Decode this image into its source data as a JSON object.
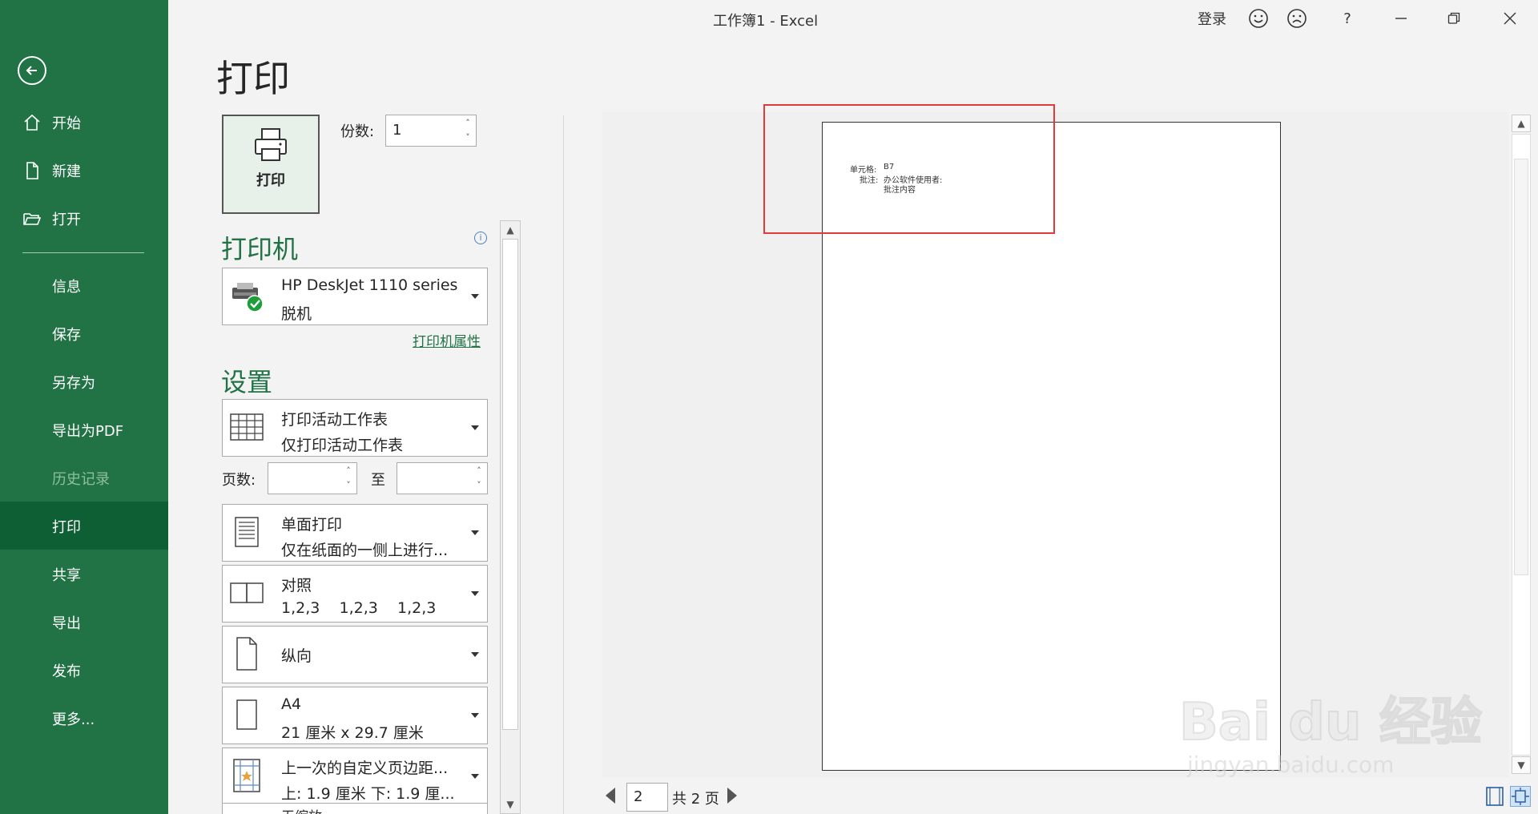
{
  "window": {
    "title": "工作簿1  -  Excel",
    "signin": "登录",
    "help": "?"
  },
  "sidebar": {
    "back_icon": "back-arrow-icon",
    "items": [
      {
        "label": "开始",
        "icon": "home-icon"
      },
      {
        "label": "新建",
        "icon": "new-document-icon"
      },
      {
        "label": "打开",
        "icon": "open-folder-icon"
      },
      {
        "label": "信息"
      },
      {
        "label": "保存"
      },
      {
        "label": "另存为"
      },
      {
        "label": "导出为PDF"
      },
      {
        "label": "历史记录",
        "disabled": true
      },
      {
        "label": "打印",
        "active": true
      },
      {
        "label": "共享"
      },
      {
        "label": "导出"
      },
      {
        "label": "发布"
      },
      {
        "label": "更多..."
      }
    ]
  },
  "print": {
    "heading": "打印",
    "button_label": "打印",
    "copies_label": "份数:",
    "copies_value": "1",
    "printer_section": "打印机",
    "printer_name": "HP DeskJet 1110 series",
    "printer_status": "脱机",
    "printer_properties": "打印机属性",
    "settings_section": "设置",
    "settings": {
      "scope_title": "打印活动工作表",
      "scope_sub": "仅打印活动工作表",
      "pages_label": "页数:",
      "pages_to": "至",
      "sides_title": "单面打印",
      "sides_sub": "仅在纸面的一侧上进行...",
      "collate_title": "对照",
      "collate_sub": "1,2,3    1,2,3    1,2,3",
      "orientation": "纵向",
      "paper_title": "A4",
      "paper_sub": "21 厘米 x 29.7 厘米",
      "margins_title": "上一次的自定义页边距...",
      "margins_sub": "上: 1.9 厘米 下: 1.9 厘...",
      "scaling_title": "无缩放"
    }
  },
  "preview": {
    "cell_label": "单元格:",
    "cell_value": "B7",
    "note_label": "批注:",
    "note_author": "办公软件使用者:",
    "note_content": "批注内容",
    "current_page": "2",
    "total_pages": "共 2 页"
  },
  "watermark": {
    "main": "Bai du 经验",
    "sub": "jingyan.baidu.com"
  },
  "colors": {
    "sidebar": "#217346",
    "sidebar_active": "#0f5f34",
    "accent_green": "#217346",
    "highlight_red": "#e53935"
  }
}
